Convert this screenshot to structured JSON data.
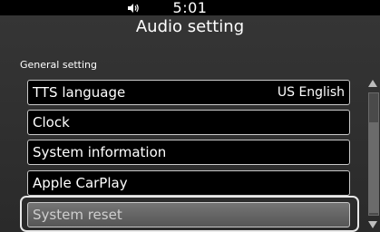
{
  "status_bar": {
    "time": "5:01",
    "icons": [
      "volume-icon"
    ]
  },
  "header": {
    "title": "Audio setting"
  },
  "section": {
    "label": "General setting"
  },
  "menu": [
    {
      "label": "TTS language",
      "value": "US English"
    },
    {
      "label": "Clock"
    },
    {
      "label": "System information"
    },
    {
      "label": "Apple CarPlay"
    },
    {
      "label": "System reset",
      "selected": true
    }
  ],
  "scrollbar": {
    "icons": [
      "scroll-up-arrow-icon",
      "scroll-down-arrow-icon"
    ]
  },
  "colors": {
    "background": "#000000",
    "panel": "#303030",
    "item_border": "#c9c9c9",
    "selected_fill": "#666666"
  }
}
